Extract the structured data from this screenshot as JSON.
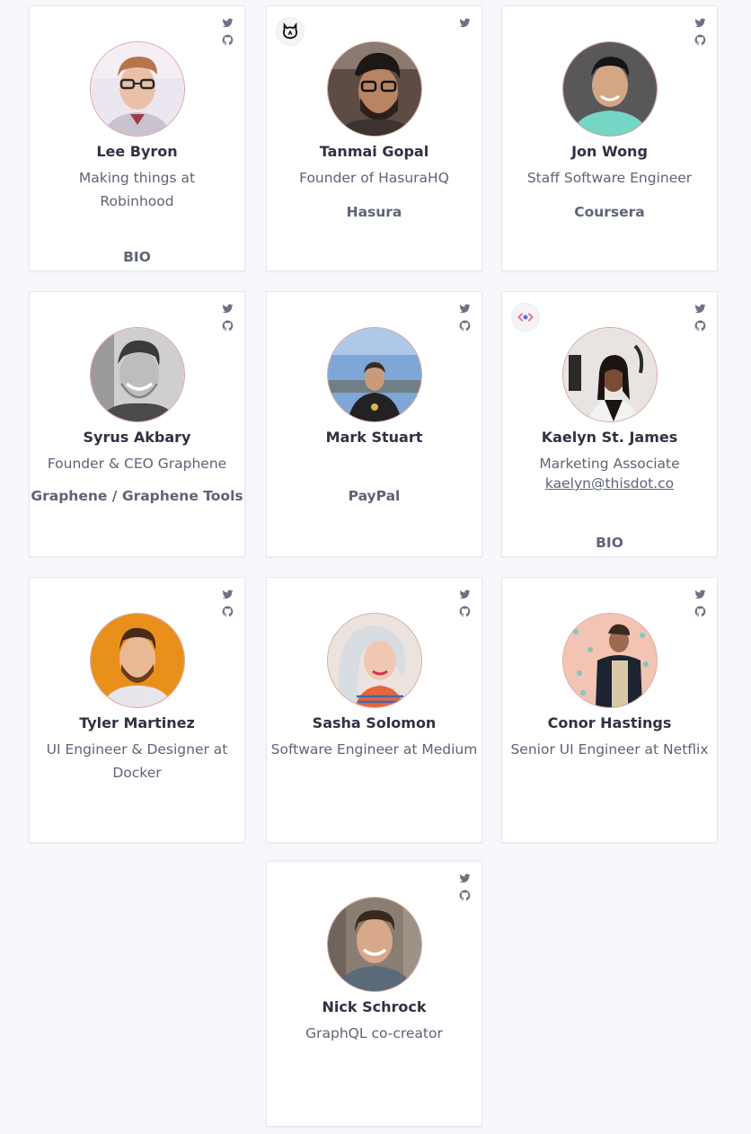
{
  "colors": {
    "background": "#f7f8fb",
    "card": "#ffffff",
    "name": "#2f3242",
    "text": "#5e6477",
    "icon": "#6c7282",
    "avatar_ring": "#d9a7a0"
  },
  "speakers": [
    {
      "name": "Lee Byron",
      "role": "Making things at Robinhood",
      "company": "",
      "email": "",
      "bio": "BIO",
      "icons": [
        "twitter-icon",
        "github-icon"
      ]
    },
    {
      "name": "Tanmai Gopal",
      "role": "Founder of HasuraHQ",
      "company": "Hasura",
      "email": "",
      "bio": "",
      "icons": [
        "twitter-icon"
      ],
      "org_logo": "hasura-logo"
    },
    {
      "name": "Jon Wong",
      "role": "Staff Software Engineer",
      "company": "Coursera",
      "email": "",
      "bio": "",
      "icons": [
        "twitter-icon",
        "github-icon"
      ]
    },
    {
      "name": "Syrus Akbary",
      "role": "Founder & CEO Graphene",
      "company": "Graphene / Graphene Tools",
      "email": "",
      "bio": "",
      "icons": [
        "twitter-icon",
        "github-icon"
      ]
    },
    {
      "name": "Mark Stuart",
      "role": "",
      "company": "PayPal",
      "email": "",
      "bio": "",
      "icons": [
        "twitter-icon",
        "github-icon"
      ]
    },
    {
      "name": "Kaelyn St. James",
      "role": "Marketing Associate",
      "company": "",
      "email": "kaelyn@thisdot.co",
      "bio": "BIO",
      "icons": [
        "twitter-icon",
        "github-icon"
      ],
      "org_logo": "thisdot-logo"
    },
    {
      "name": "Tyler Martinez",
      "role": "UI Engineer & Designer at Docker",
      "company": "",
      "email": "",
      "bio": "",
      "icons": [
        "twitter-icon",
        "github-icon"
      ]
    },
    {
      "name": "Sasha Solomon",
      "role": "Software Engineer at Medium",
      "company": "",
      "email": "",
      "bio": "",
      "icons": [
        "twitter-icon",
        "github-icon"
      ]
    },
    {
      "name": "Conor Hastings",
      "role": "Senior UI Engineer at Netflix",
      "company": "",
      "email": "",
      "bio": "",
      "icons": [
        "twitter-icon",
        "github-icon"
      ]
    },
    {
      "name": "Nick Schrock",
      "role": "GraphQL co-creator",
      "company": "",
      "email": "",
      "bio": "",
      "icons": [
        "twitter-icon",
        "github-icon"
      ]
    }
  ]
}
